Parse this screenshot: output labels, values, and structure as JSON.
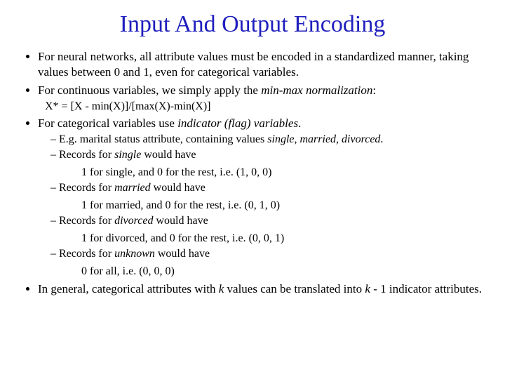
{
  "title": "Input And Output Encoding",
  "b1": "For neural networks, all attribute values must be encoded in a standardized manner, taking values between 0 and 1, even for categorical variables.",
  "b2a": "For continuous variables, we simply apply the ",
  "b2b": "min-max normalization",
  "b2c": ":",
  "formula": "X* = [X - min(X)]/[max(X)-min(X)]",
  "b3a": "For categorical variables use ",
  "b3b": "indicator (flag) variables",
  "b3c": ".",
  "s1a": "E.g. marital status attribute, containing values ",
  "s1b": "single, married, divorced",
  "s1c": ".",
  "s2a": "Records for ",
  "s2b": "single",
  "s2c": " would have",
  "d2": "1 for single, and 0 for the rest, i.e. (1, 0, 0)",
  "s3a": "Records for ",
  "s3b": "married",
  "s3c": " would have",
  "d3": "1 for married, and 0 for the rest, i.e. (0, 1, 0)",
  "s4a": "Records for ",
  "s4b": "divorced",
  "s4c": " would have",
  "d4": "1 for divorced, and 0 for the rest, i.e. (0, 0, 1)",
  "s5a": "Records for ",
  "s5b": "unknown",
  "s5c": " would have",
  "d5": "0 for all, i.e. (0, 0, 0)",
  "b4a": "In general, categorical attributes with ",
  "b4b": "k",
  "b4c": " values can be translated into ",
  "b4d": "k",
  "b4e": " - 1 indicator attributes."
}
